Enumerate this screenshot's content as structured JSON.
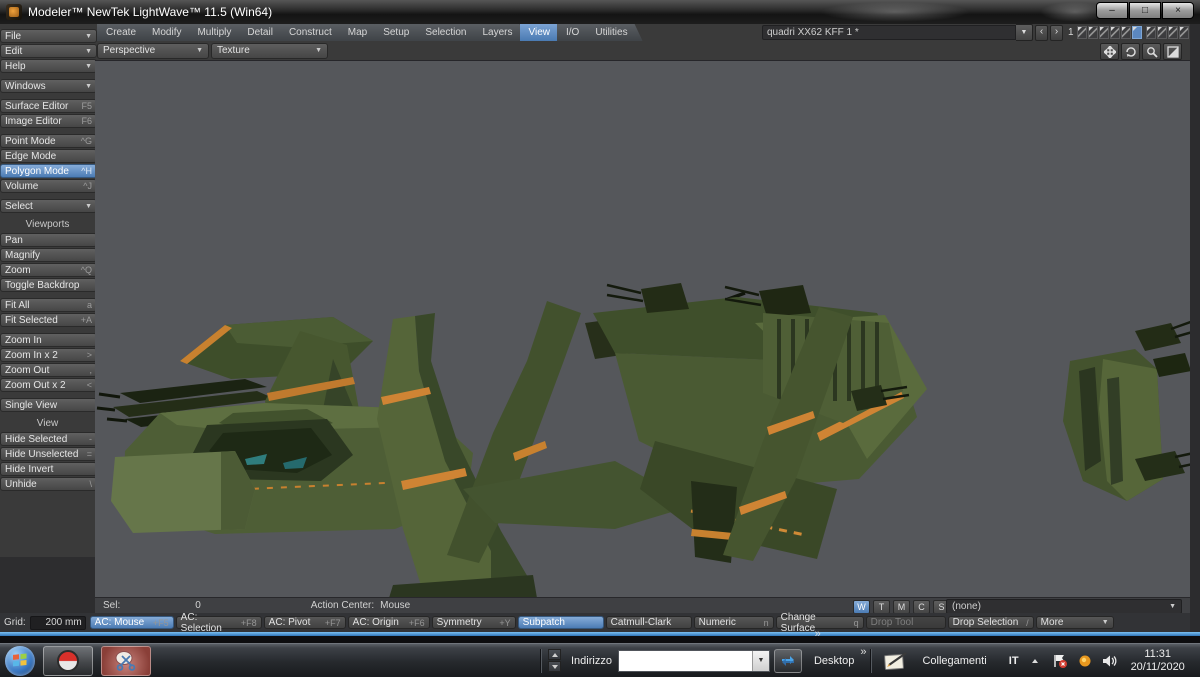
{
  "window": {
    "title": "Modeler™ NewTek LightWave™ 11.5 (Win64)",
    "minimize": "–",
    "maximize": "□",
    "close": "×"
  },
  "glyphs": {
    "caret_down": "▼",
    "prev": "‹",
    "next": "›",
    "overflow": "»"
  },
  "tabs": {
    "items": [
      "Create",
      "Modify",
      "Multiply",
      "Detail",
      "Construct",
      "Map",
      "Setup",
      "Selection",
      "Layers",
      "View",
      "I/O",
      "Utilities"
    ],
    "active": "View"
  },
  "object_bar": {
    "current_object": "quadri XX62  KFF 1 *",
    "frame": "1"
  },
  "viewport_bar": {
    "view_type": "Perspective",
    "shading": "Texture"
  },
  "sidebar": {
    "file": "File",
    "edit": "Edit",
    "help": "Help",
    "windows": "Windows",
    "surface_editor": {
      "label": "Surface Editor",
      "key": "F5"
    },
    "image_editor": {
      "label": "Image Editor",
      "key": "F6"
    },
    "point_mode": {
      "label": "Point Mode",
      "key": "^G"
    },
    "edge_mode": {
      "label": "Edge Mode",
      "key": ""
    },
    "polygon_mode": {
      "label": "Polygon Mode",
      "key": "^H"
    },
    "volume": {
      "label": "Volume",
      "key": "^J"
    },
    "select": "Select",
    "viewports_header": "Viewports",
    "pan": "Pan",
    "magnify": "Magnify",
    "zoom": {
      "label": "Zoom",
      "key": "^Q"
    },
    "toggle_backdrop": "Toggle Backdrop",
    "fit_all": {
      "label": "Fit All",
      "key": "a"
    },
    "fit_selected": {
      "label": "Fit Selected",
      "key": "+A"
    },
    "zoom_in": {
      "label": "Zoom In",
      "key": ""
    },
    "zoom_in_x2": {
      "label": "Zoom In x 2",
      "key": ">"
    },
    "zoom_out": {
      "label": "Zoom Out",
      "key": ","
    },
    "zoom_out_x2": {
      "label": "Zoom Out x 2",
      "key": "<"
    },
    "single_view": "Single View",
    "view_header": "View",
    "hide_selected": {
      "label": "Hide Selected",
      "key": "-"
    },
    "hide_unselected": {
      "label": "Hide Unselected",
      "key": "="
    },
    "hide_invert": {
      "label": "Hide Invert",
      "key": ""
    },
    "unhide": {
      "label": "Unhide",
      "key": "\\"
    }
  },
  "status": {
    "sel_label": "Sel:",
    "sel_value": "0",
    "action_center_label": "Action Center:",
    "action_center_value": "Mouse",
    "wtmcs": [
      "W",
      "T",
      "M",
      "C",
      "S"
    ],
    "surface_dropdown": "(none)",
    "grid_label": "Grid:",
    "grid_value": "200 mm",
    "ac_mouse": {
      "label": "AC: Mouse",
      "key": "+F5"
    },
    "ac_selection": {
      "label": "AC: Selection",
      "key": "+F8"
    },
    "ac_pivot": {
      "label": "AC: Pivot",
      "key": "+F7"
    },
    "ac_origin": {
      "label": "AC: Origin",
      "key": "+F6"
    },
    "symmetry": {
      "label": "Symmetry",
      "key": "+Y"
    },
    "subpatch": {
      "label": "Subpatch",
      "key": ""
    },
    "catmull_clark": {
      "label": "Catmull-Clark",
      "key": ""
    },
    "numeric": {
      "label": "Numeric",
      "key": "n"
    },
    "change_surface": {
      "label": "Change Surface",
      "key": "q"
    },
    "drop_tool": {
      "label": "Drop Tool",
      "key": ""
    },
    "drop_selection": {
      "label": "Drop Selection",
      "key": "/"
    },
    "more": {
      "label": "More",
      "key": ""
    }
  },
  "taskbar": {
    "address_label": "Indirizzo",
    "address_value": "",
    "desktop_label": "Desktop",
    "links_label": "Collegamenti",
    "language": "IT",
    "time": "11:31",
    "date": "20/11/2020"
  },
  "viewport": {
    "background": "#55575b",
    "model_palette": {
      "base": "#4a5a33",
      "light": "#5d6e40",
      "dark": "#333f22",
      "gun_dark": "#1b2312",
      "accent_orange": "#cf8434",
      "glass_teal": "#2f7d7d"
    }
  }
}
